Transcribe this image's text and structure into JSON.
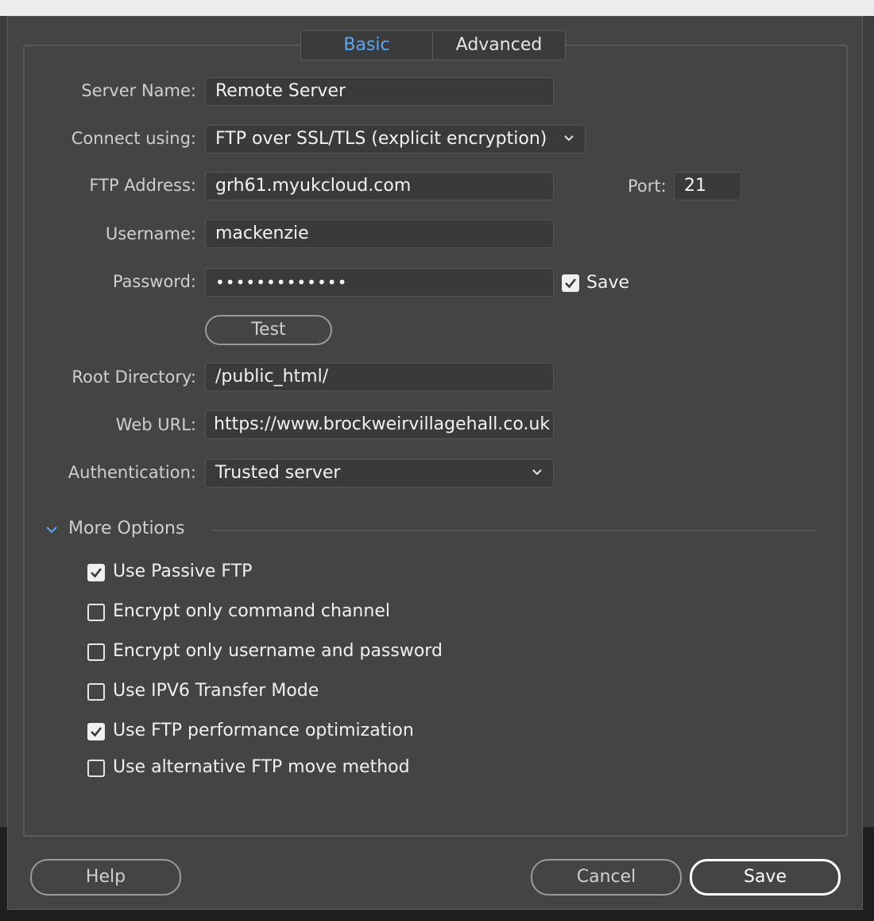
{
  "tabs": {
    "basic": "Basic",
    "advanced": "Advanced"
  },
  "form": {
    "server_name": {
      "label": "Server Name:",
      "value": "Remote Server"
    },
    "connect_using": {
      "label": "Connect using:",
      "value": "FTP over SSL/TLS (explicit encryption)"
    },
    "ftp_address": {
      "label": "FTP Address:",
      "value": "grh61.myukcloud.com"
    },
    "port": {
      "label": "Port:",
      "value": "21"
    },
    "username": {
      "label": "Username:",
      "value": "mackenzie"
    },
    "password": {
      "label": "Password:",
      "value": "•••••••••••••",
      "save_label": "Save",
      "save_checked": true
    },
    "test_label": "Test",
    "root_directory": {
      "label": "Root Directory:",
      "value": "/public_html/"
    },
    "web_url": {
      "label": "Web URL:",
      "value": "https://www.brockweirvillagehall.co.uk"
    },
    "authentication": {
      "label": "Authentication:",
      "value": "Trusted server"
    }
  },
  "more_options": {
    "title": "More Options",
    "items": [
      {
        "label": "Use Passive FTP",
        "checked": true
      },
      {
        "label": "Encrypt only command channel",
        "checked": false
      },
      {
        "label": "Encrypt only username and password",
        "checked": false
      },
      {
        "label": "Use IPV6 Transfer Mode",
        "checked": false
      },
      {
        "label": "Use FTP performance optimization",
        "checked": true
      },
      {
        "label": "Use alternative FTP move method",
        "checked": false
      }
    ]
  },
  "footer": {
    "help": "Help",
    "cancel": "Cancel",
    "save": "Save"
  },
  "colors": {
    "dialog_bg": "#444444",
    "accent": "#59a6f2",
    "field_bg": "#3a3a3a"
  },
  "icons": {
    "dropdown": "chevron-down-icon",
    "check": "checkmark-icon",
    "disclosure": "disclosure-chevron-icon"
  }
}
